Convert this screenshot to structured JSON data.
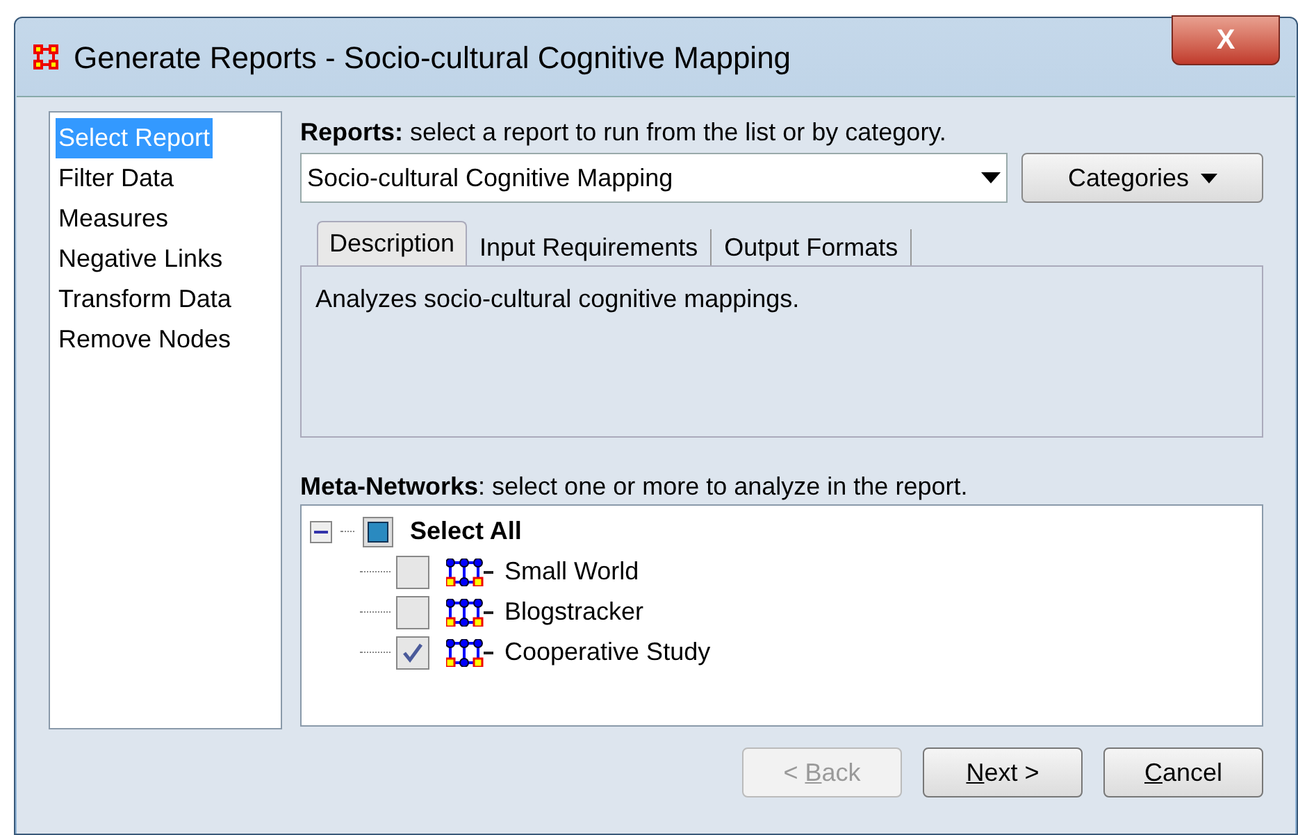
{
  "window": {
    "title": "Generate Reports - Socio-cultural Cognitive Mapping",
    "close": "X"
  },
  "sidebar": {
    "items": [
      {
        "label": "Select Report",
        "selected": true
      },
      {
        "label": "Filter Data",
        "selected": false
      },
      {
        "label": "Measures",
        "selected": false
      },
      {
        "label": "Negative Links",
        "selected": false
      },
      {
        "label": "Transform Data",
        "selected": false
      },
      {
        "label": "Remove Nodes",
        "selected": false
      }
    ]
  },
  "reports": {
    "label_bold": "Reports:",
    "label": "select a report to run from the list or by category.",
    "value": "Socio-cultural Cognitive Mapping",
    "categories_button": "Categories"
  },
  "tabs": [
    {
      "label": "Description",
      "selected": true
    },
    {
      "label": "Input Requirements",
      "selected": false
    },
    {
      "label": "Output Formats",
      "selected": false
    }
  ],
  "description": "Analyzes socio-cultural cognitive mappings.",
  "meta_networks": {
    "label_bold": "Meta-Networks",
    "label": ": select one or more to analyze in the report.",
    "tree": {
      "label": "Select All",
      "expanded": true,
      "children": [
        {
          "label": "Small World",
          "checked": false
        },
        {
          "label": "Blogstracker",
          "checked": false
        },
        {
          "label": "Cooperative Study",
          "checked": true
        }
      ]
    }
  },
  "buttons": [
    {
      "pre": "< ",
      "key": "B",
      "post": "ack",
      "disabled": true
    },
    {
      "key": "N",
      "post": "ext >",
      "disabled": false
    },
    {
      "key": "C",
      "post": "ancel",
      "disabled": false
    }
  ]
}
